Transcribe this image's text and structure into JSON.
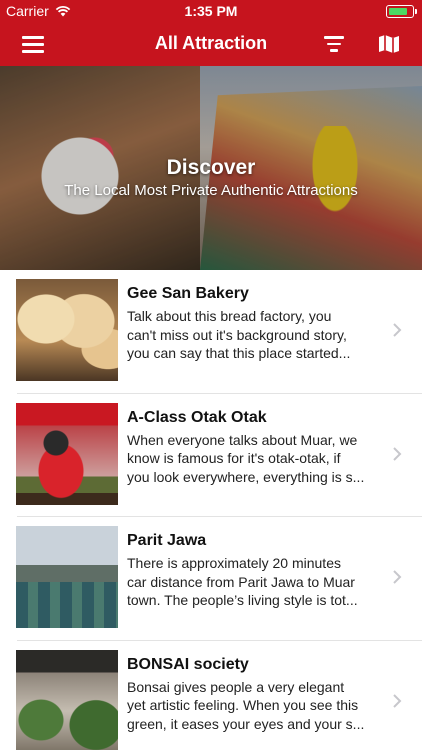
{
  "status_bar": {
    "carrier": "Carrier",
    "time": "1:35 PM",
    "battery_level": 0.85
  },
  "nav": {
    "title": "All Attraction",
    "left_icon": "hamburger-menu-icon",
    "right_icons": [
      "filter-icon",
      "map-icon"
    ]
  },
  "hero": {
    "title": "Discover",
    "subtitle": "The Local Most Private Authentic Attractions"
  },
  "attractions": [
    {
      "title": "Gee San Bakery",
      "desc_lines": [
        "Talk about this bread factory, you",
        "can't miss out it's background story,",
        "you can say that this place started..."
      ]
    },
    {
      "title": "A-Class Otak Otak",
      "desc_lines": [
        "When everyone talks about Muar, we",
        "know is famous for it's otak-otak, if",
        "you look everywhere, everything is s..."
      ]
    },
    {
      "title": "Parit Jawa",
      "desc_lines": [
        "There is approximately 20 minutes",
        "car distance from Parit Jawa to Muar",
        "town. The people’s living style is tot..."
      ]
    },
    {
      "title": "BONSAI society",
      "desc_lines": [
        "Bonsai gives people a very elegant",
        "yet artistic feeling. When you see this",
        "green, it eases your eyes and your s..."
      ]
    }
  ],
  "colors": {
    "brand_red": "#c6141e",
    "divider": "#e3e3e3",
    "chevron": "#c7c7cc"
  }
}
